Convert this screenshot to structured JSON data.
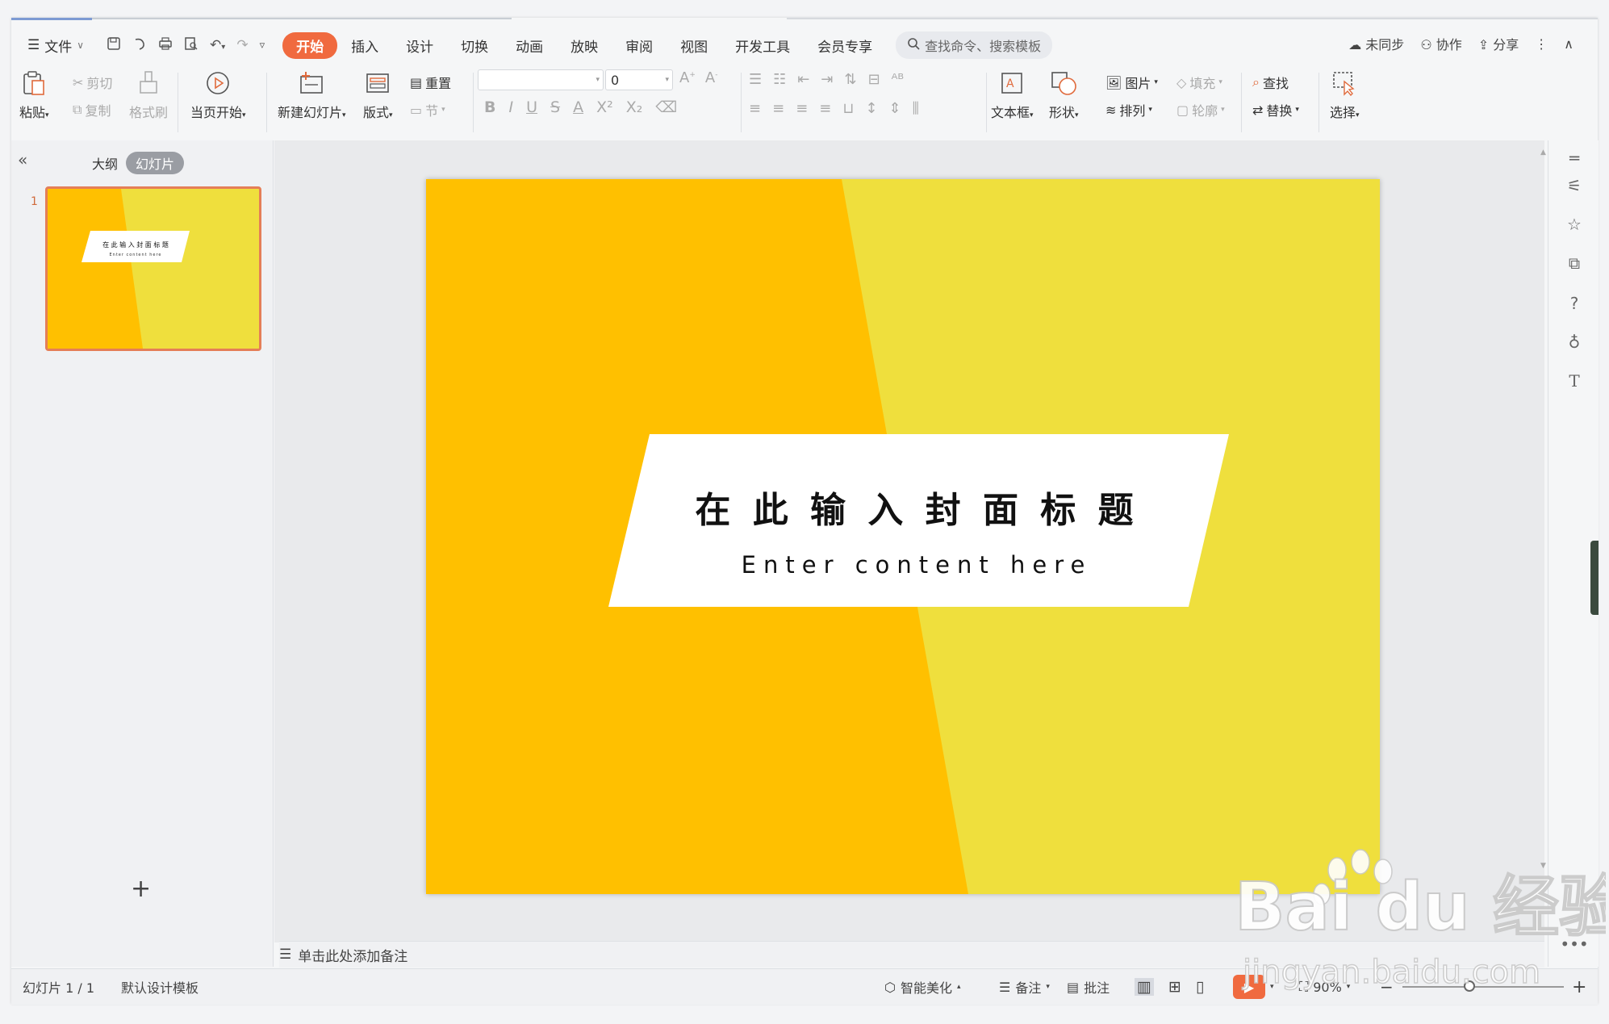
{
  "menu": {
    "file_label": "文件",
    "tabs": [
      "开始",
      "插入",
      "设计",
      "切换",
      "动画",
      "放映",
      "审阅",
      "视图",
      "开发工具",
      "会员专享"
    ],
    "active_tab": "开始",
    "search_placeholder": "查找命令、搜索模板",
    "right_actions": [
      "未同步",
      "协作",
      "分享"
    ]
  },
  "ribbon": {
    "paste": "粘贴",
    "cut": "剪切",
    "copy": "复制",
    "format_painter": "格式刷",
    "play_current": "当页开始",
    "new_slide": "新建幻灯片",
    "layout": "版式",
    "reset": "重置",
    "section": "节",
    "font_size_value": "0",
    "textbox": "文本框",
    "shape": "形状",
    "picture": "图片",
    "fill": "填充",
    "arrange": "排列",
    "outline": "轮廓",
    "find": "查找",
    "replace": "替换",
    "select": "选择"
  },
  "left_panel": {
    "tab_outline": "大纲",
    "tab_slides": "幻灯片",
    "slide_number": "1"
  },
  "slide": {
    "title": "在 此 输 入 封 面 标 题",
    "subtitle": "Enter content here",
    "colors": {
      "left": "#ffc000",
      "right": "#efdf3d",
      "box": "#ffffff"
    }
  },
  "notes_placeholder": "单击此处添加备注",
  "status": {
    "slide_count": "幻灯片 1 / 1",
    "template": "默认设计模板",
    "beautify": "智能美化",
    "notes": "备注",
    "comments": "批注",
    "zoom": "90%"
  },
  "watermark": {
    "logo_text": "Bai du 经验",
    "url": "jingyan.baidu.com"
  }
}
